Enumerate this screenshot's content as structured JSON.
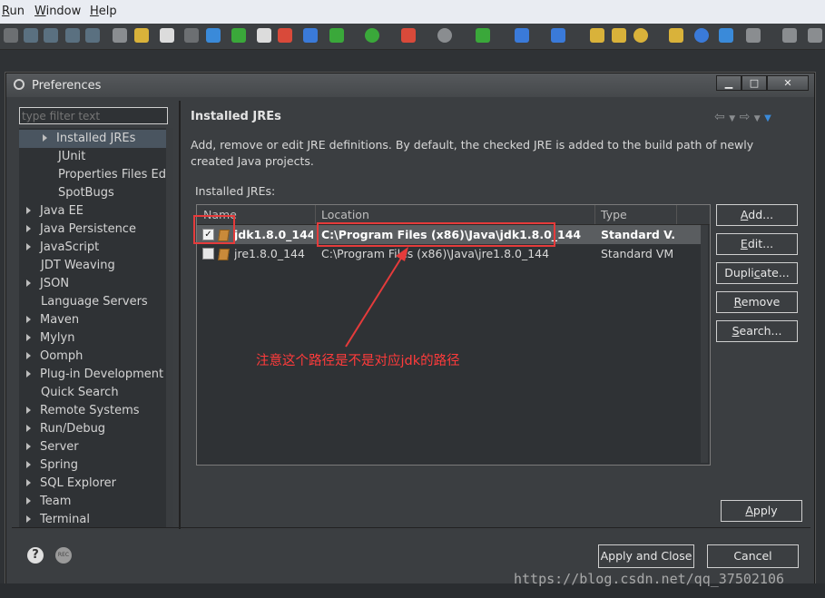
{
  "menubar": {
    "items": [
      {
        "label": "Run",
        "underline": "R",
        "rest": "un"
      },
      {
        "label": "Window",
        "underline": "W",
        "rest": "indow"
      },
      {
        "label": "Help",
        "underline": "H",
        "rest": "elp"
      }
    ]
  },
  "dialog": {
    "title": "Preferences",
    "filter_placeholder": "type filter text",
    "tree": [
      {
        "label": "Installed JREs",
        "expandable": true,
        "selected": true,
        "indent": 1
      },
      {
        "label": "JUnit",
        "expandable": false,
        "indent": 2
      },
      {
        "label": "Properties Files Edito",
        "expandable": false,
        "indent": 2
      },
      {
        "label": "SpotBugs",
        "expandable": false,
        "indent": 2
      },
      {
        "label": "Java EE",
        "expandable": true,
        "indent": 0
      },
      {
        "label": "Java Persistence",
        "expandable": true,
        "indent": 0
      },
      {
        "label": "JavaScript",
        "expandable": true,
        "indent": 0
      },
      {
        "label": "JDT Weaving",
        "expandable": false,
        "indent": 0
      },
      {
        "label": "JSON",
        "expandable": true,
        "indent": 0
      },
      {
        "label": "Language Servers",
        "expandable": false,
        "indent": 0
      },
      {
        "label": "Maven",
        "expandable": true,
        "indent": 0
      },
      {
        "label": "Mylyn",
        "expandable": true,
        "indent": 0
      },
      {
        "label": "Oomph",
        "expandable": true,
        "indent": 0
      },
      {
        "label": "Plug-in Development",
        "expandable": true,
        "indent": 0
      },
      {
        "label": "Quick Search",
        "expandable": false,
        "indent": 0
      },
      {
        "label": "Remote Systems",
        "expandable": true,
        "indent": 0
      },
      {
        "label": "Run/Debug",
        "expandable": true,
        "indent": 0
      },
      {
        "label": "Server",
        "expandable": true,
        "indent": 0
      },
      {
        "label": "Spring",
        "expandable": true,
        "indent": 0
      },
      {
        "label": "SQL Explorer",
        "expandable": true,
        "indent": 0
      },
      {
        "label": "Team",
        "expandable": true,
        "indent": 0
      },
      {
        "label": "Terminal",
        "expandable": true,
        "indent": 0
      }
    ],
    "page": {
      "title": "Installed JREs",
      "description": "Add, remove or edit JRE definitions. By default, the checked JRE is added to the build path of newly created Java projects.",
      "table_label": "Installed JREs:",
      "columns": [
        "Name",
        "Location",
        "Type"
      ],
      "rows": [
        {
          "checked": true,
          "name": "jdk1.8.0_144...",
          "location": "C:\\Program Files (x86)\\Java\\jdk1.8.0_144",
          "type": "Standard V...",
          "selected": true
        },
        {
          "checked": false,
          "name": "jre1.8.0_144",
          "location": "C:\\Program Files (x86)\\Java\\jre1.8.0_144",
          "type": "Standard VM",
          "selected": false
        }
      ],
      "buttons": {
        "add": {
          "u": "A",
          "rest": "dd..."
        },
        "edit": {
          "u": "E",
          "rest": "dit..."
        },
        "duplicate": {
          "pre": "Dupli",
          "u": "c",
          "rest": "ate..."
        },
        "remove": {
          "u": "R",
          "rest": "emove"
        },
        "search": {
          "u": "S",
          "rest": "earch..."
        },
        "apply": {
          "u": "A",
          "rest": "pply"
        }
      }
    },
    "footer": {
      "apply_close": "Apply and Close",
      "cancel": "Cancel"
    }
  },
  "annotation": "注意这个路径是不是对应jdk的路径",
  "watermark": "https://blog.csdn.net/qq_37502106",
  "colors": {
    "accent_red": "#e53b3b",
    "selection": "#5a5d60"
  }
}
